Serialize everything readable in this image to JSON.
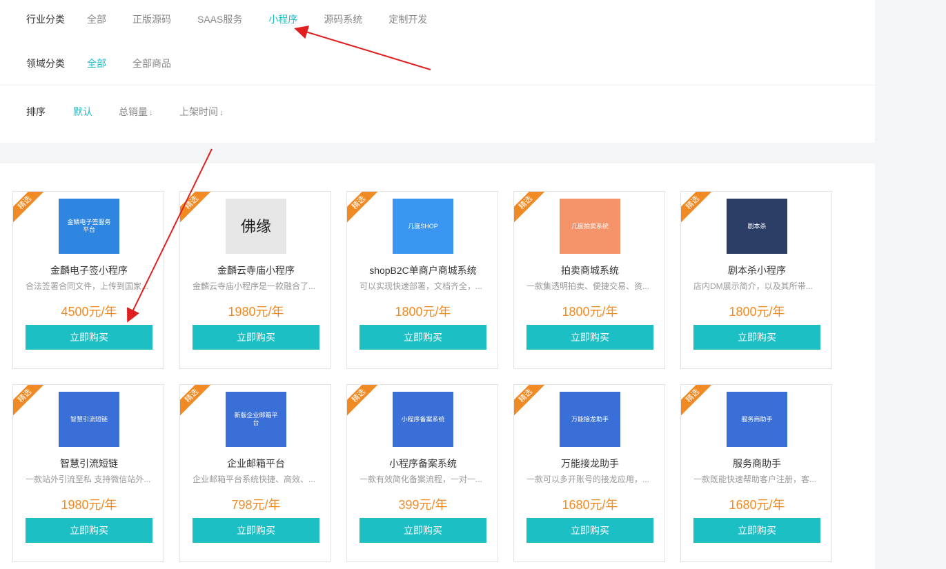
{
  "filters": {
    "industry": {
      "label": "行业分类",
      "options": [
        "全部",
        "正版源码",
        "SAAS服务",
        "小程序",
        "源码系统",
        "定制开发"
      ],
      "active": "小程序"
    },
    "domain": {
      "label": "领域分类",
      "options": [
        "全部",
        "全部商品"
      ],
      "active": "全部"
    },
    "sort": {
      "label": "排序",
      "options": [
        "默认",
        "总销量",
        "上架时间"
      ],
      "active": "默认",
      "arrow": "↓"
    }
  },
  "products": [
    {
      "badge": "精选",
      "thumb_text": "金鳞电子签服务平台",
      "title": "金麟电子签小程序",
      "desc": "合法签署合同文件，上传到国家...",
      "price": "4500元/年",
      "button": "立即购买",
      "thumb_color": "#2f86e0"
    },
    {
      "badge": "精选",
      "thumb_text": "佛缘",
      "title": "金麟云寺庙小程序",
      "desc": "金麟云寺庙小程序是一款融合了...",
      "price": "1980元/年",
      "button": "立即购买",
      "thumb_color": "#e6e6e6"
    },
    {
      "badge": "精选",
      "thumb_text": "几度SHOP",
      "title": "shopB2C单商户商城系统",
      "desc": "可以实现快速部署，文档齐全，...",
      "price": "1800元/年",
      "button": "立即购买",
      "thumb_color": "#3a96f0"
    },
    {
      "badge": "精选",
      "thumb_text": "几度拍卖系统",
      "title": "拍卖商城系统",
      "desc": "一款集透明拍卖、便捷交易、资...",
      "price": "1800元/年",
      "button": "立即购买",
      "thumb_color": "#f5946a"
    },
    {
      "badge": "精选",
      "thumb_text": "剧本杀",
      "title": "剧本杀小程序",
      "desc": "店内DM展示简介，以及其所带...",
      "price": "1800元/年",
      "button": "立即购买",
      "thumb_color": "#2c3e66"
    },
    {
      "badge": "精选",
      "thumb_text": "智慧引流短链",
      "title": "智慧引流短链",
      "desc": "一款站外引流至私 支持微信站外...",
      "price": "1980元/年",
      "button": "立即购买",
      "thumb_color": "#3b6fd8"
    },
    {
      "badge": "精选",
      "thumb_text": "新版企业邮箱平台",
      "title": "企业邮箱平台",
      "desc": "企业邮箱平台系统快捷、高效、...",
      "price": "798元/年",
      "button": "立即购买",
      "thumb_color": "#3b6fd8"
    },
    {
      "badge": "精选",
      "thumb_text": "小程序备案系统",
      "title": "小程序备案系统",
      "desc": "一款有效简化备案流程，一对一...",
      "price": "399元/年",
      "button": "立即购买",
      "thumb_color": "#3b6fd8"
    },
    {
      "badge": "精选",
      "thumb_text": "万能接龙助手",
      "title": "万能接龙助手",
      "desc": "一款可以多开账号的接龙应用，...",
      "price": "1680元/年",
      "button": "立即购买",
      "thumb_color": "#3b6fd8"
    },
    {
      "badge": "精选",
      "thumb_text": "服务商助手",
      "title": "服务商助手",
      "desc": "一款既能快速帮助客户注册，客...",
      "price": "1680元/年",
      "button": "立即购买",
      "thumb_color": "#3b6fd8"
    }
  ],
  "colors": {
    "accent": "#1cbfc3",
    "price": "#f08a24",
    "badge": "#f08a24",
    "annotation_arrow": "#e02020"
  }
}
